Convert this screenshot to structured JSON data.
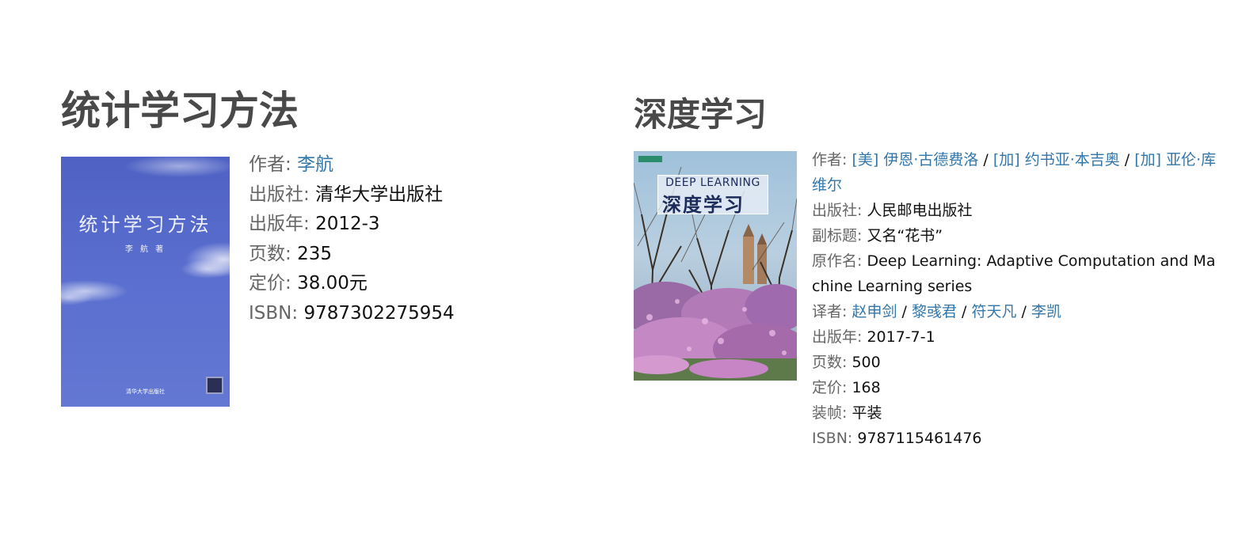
{
  "books": [
    {
      "title": "统计学习方法",
      "cover": {
        "title": "统计学习方法",
        "author": "李 航 著",
        "publisher": "清华大学出版社"
      },
      "author_label": "作者:",
      "authors": [
        "李航"
      ],
      "publisher_label": "出版社:",
      "publisher": "清华大学出版社",
      "year_label": "出版年:",
      "year": "2012-3",
      "pages_label": "页数:",
      "pages": "235",
      "price_label": "定价:",
      "price": "38.00元",
      "isbn_label": "ISBN:",
      "isbn": "9787302275954"
    },
    {
      "title": "深度学习",
      "cover": {
        "en_title": "DEEP LEARNING",
        "zh_title": "深度学习"
      },
      "author_label": "作者:",
      "authors": [
        "[美] 伊恩·古德费洛",
        "[加] 约书亚·本吉奥",
        "[加] 亚伦·库维尔"
      ],
      "publisher_label": "出版社:",
      "publisher": "人民邮电出版社",
      "subtitle_label": "副标题:",
      "subtitle": "又名“花书”",
      "original_label": "原作名:",
      "original": "Deep Learning: Adaptive Computation and Machine Learning series",
      "translator_label": "译者:",
      "translators": [
        "赵申剑",
        "黎彧君",
        "符天凡",
        "李凯"
      ],
      "year_label": "出版年:",
      "year": "2017-7-1",
      "pages_label": "页数:",
      "pages": "500",
      "price_label": "定价:",
      "price": "168",
      "binding_label": "装帧:",
      "binding": "平装",
      "isbn_label": "ISBN:",
      "isbn": "9787115461476"
    }
  ],
  "separator": " / ",
  "colors": {
    "link": "#3377aa",
    "label": "#666666",
    "title": "#494949"
  }
}
